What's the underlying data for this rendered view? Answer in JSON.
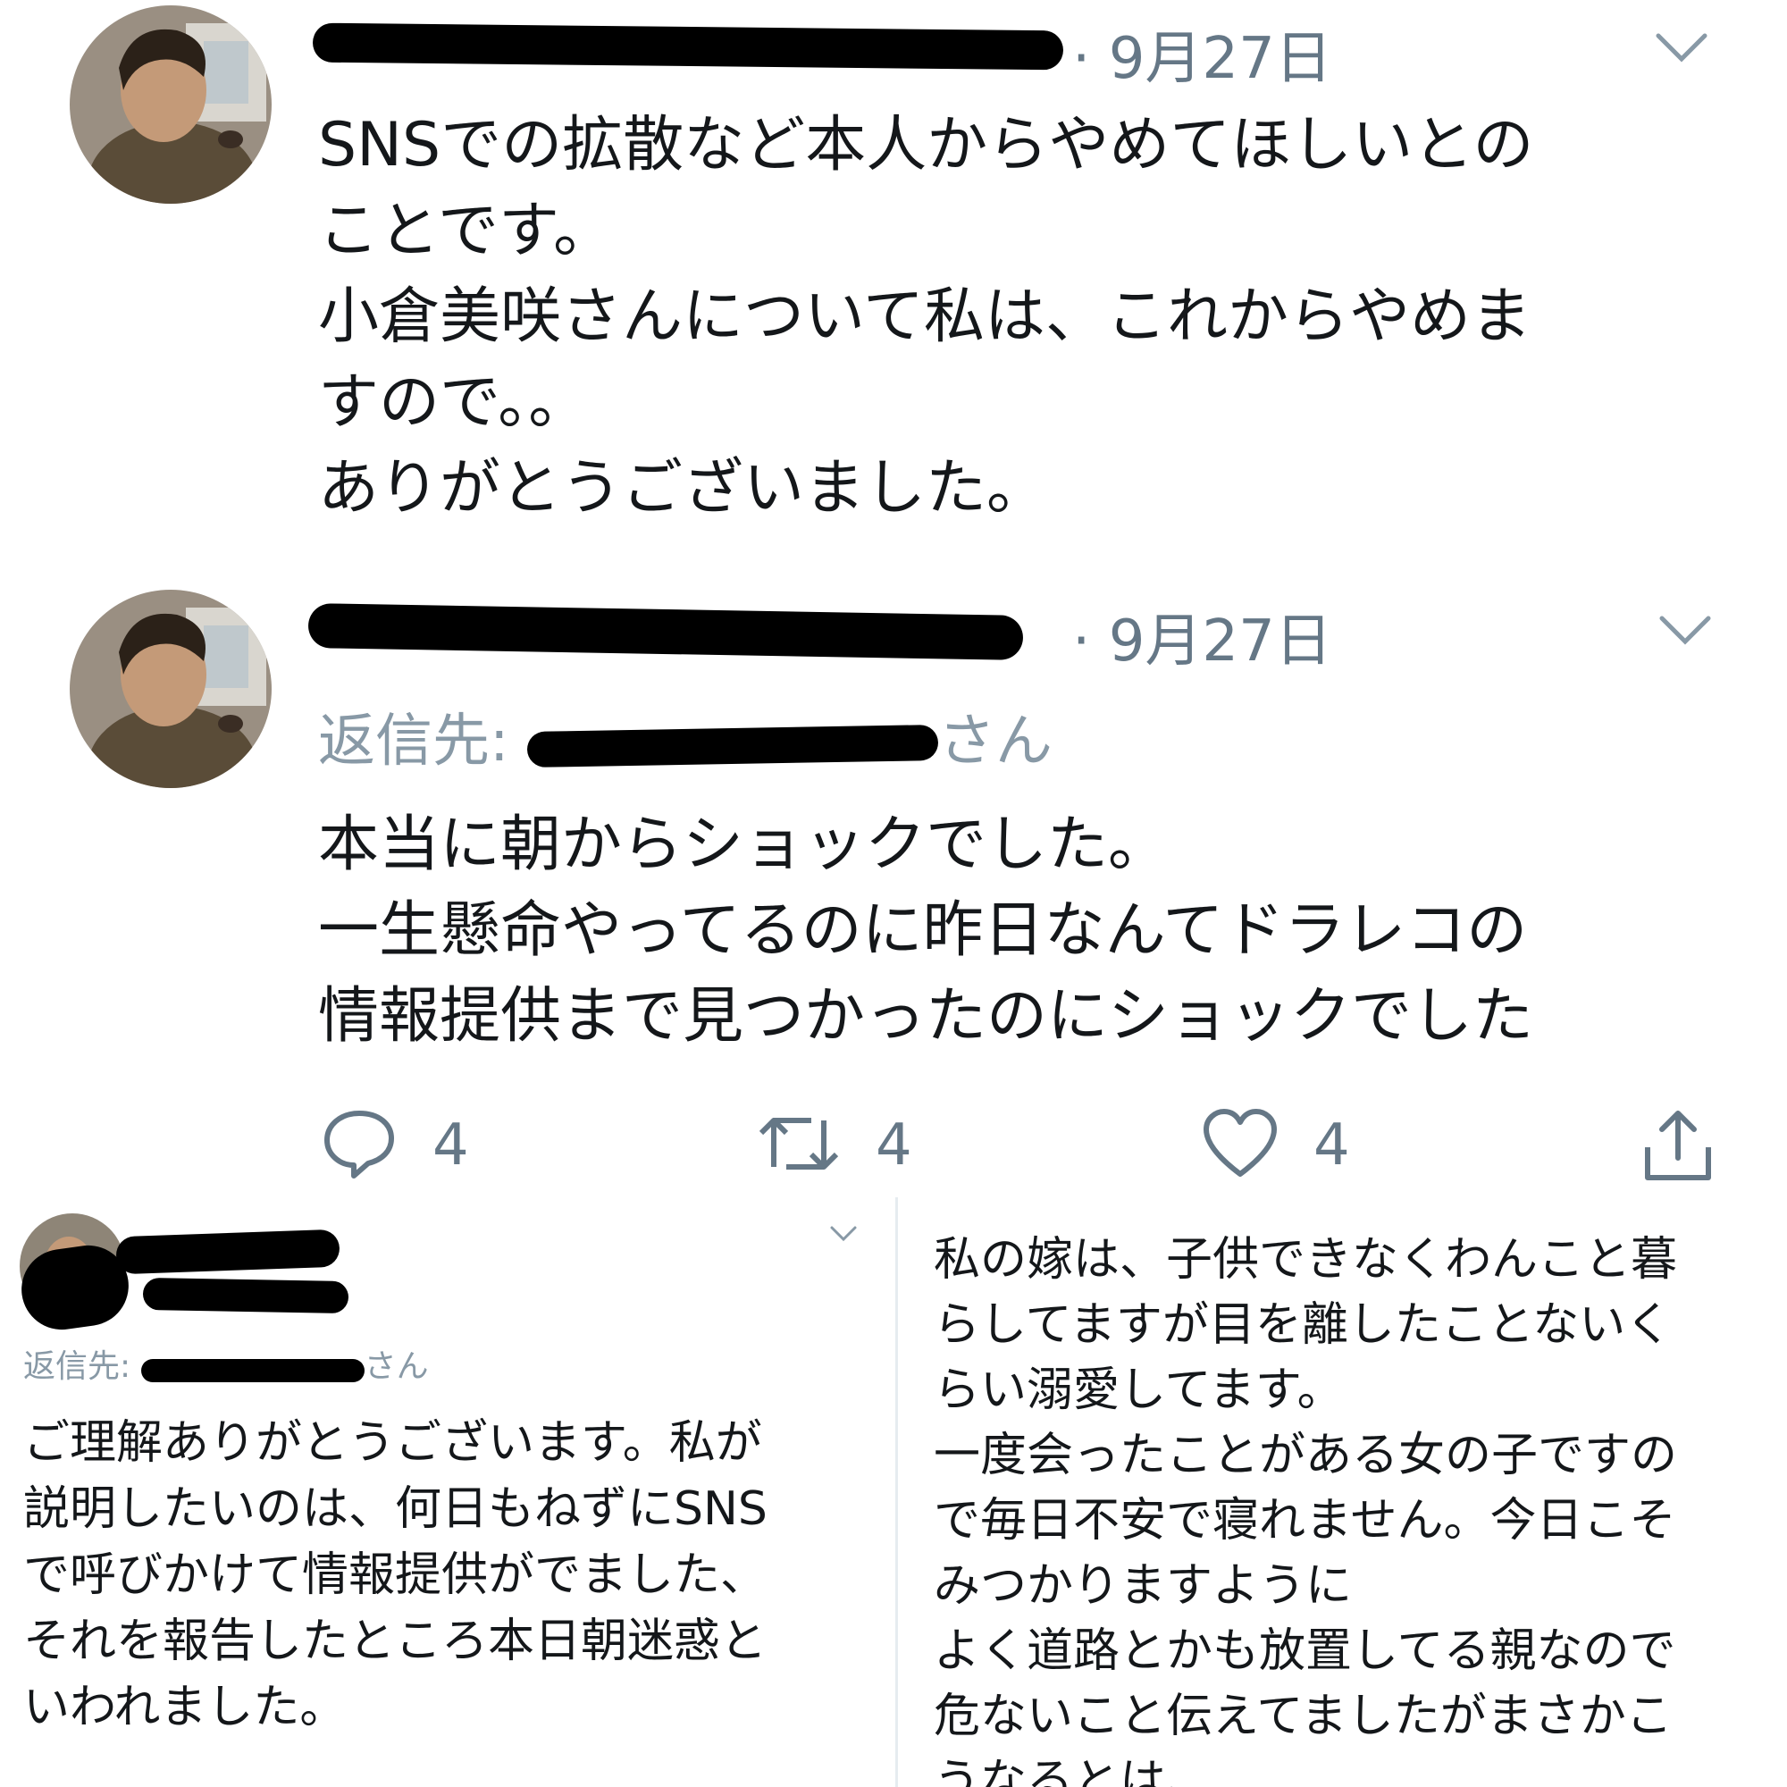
{
  "tweet1": {
    "date": "· 9月27日",
    "text": "SNSでの拡散など本人からやめてほしいとの\nことです。\n小倉美咲さんについて私は、これからやめま\nすので。。\nありがとうございました。"
  },
  "tweet2": {
    "date": "· 9月27日",
    "reply_prefix": "返信先: ",
    "reply_suffix": "さん",
    "text": "本当に朝からショックでした。\n一生懸命やってるのに昨日なんてドラレコの\n情報提供まで見つかったのにショックでした",
    "actions": {
      "reply_count": "4",
      "retweet_count": "4",
      "like_count": "4"
    }
  },
  "tweet3": {
    "reply_prefix": "返信先: ",
    "reply_suffix": "さん",
    "text": "ご理解ありがとうございます。私が\n説明したいのは、何日もねずにSNS\nで呼びかけて情報提供がでました、\nそれを報告したところ本日朝迷惑と\nいわれました。"
  },
  "tweet4": {
    "text": "私の嫁は、子供できなくわんこと暮\nらしてますが目を離したことないく\nらい溺愛してます。\n一度会ったことがある女の子ですの\nで毎日不安で寝れません。今日こそ\nみつかりますように\nよく道路とかも放置してる親なので\n危ないこと伝えてましたがまさかこ\nうなるとは、"
  },
  "colors": {
    "text": "#14171a",
    "meta": "#657786",
    "link": "#1da1f2"
  }
}
